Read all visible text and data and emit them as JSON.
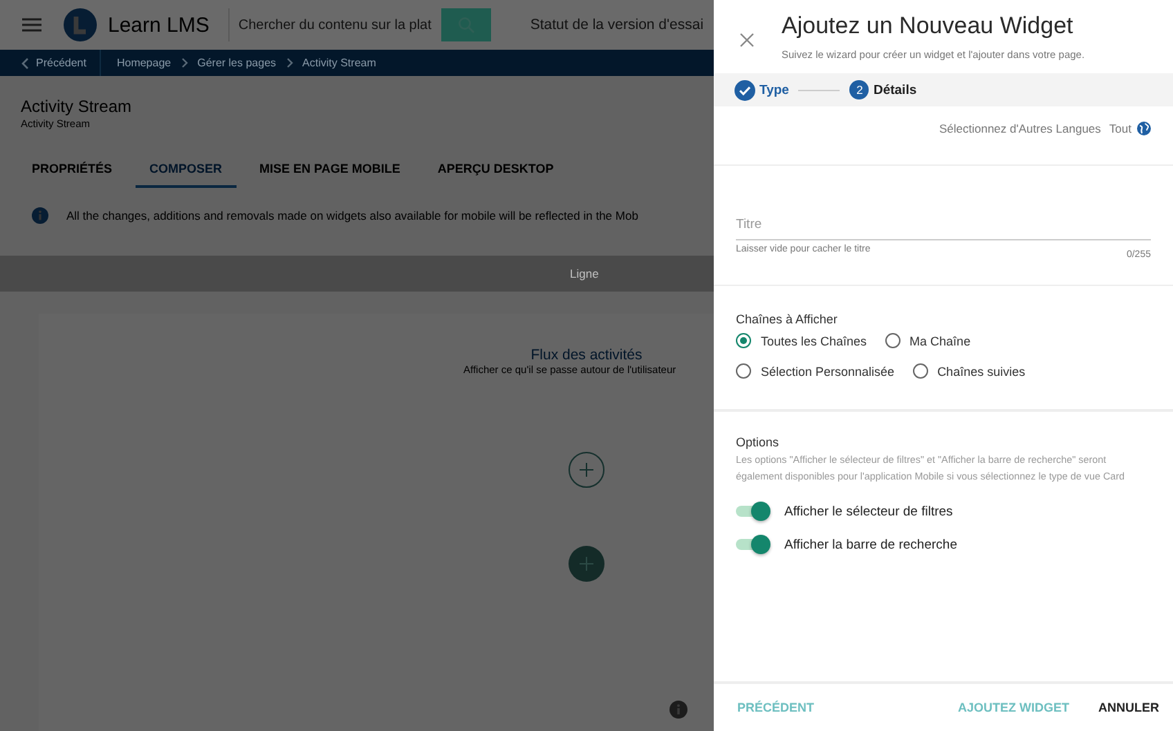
{
  "header": {
    "app_name": "Learn LMS",
    "search": {
      "placeholder": "Chercher du contenu sur la plat"
    },
    "trial_status": "Statut de la version d'essai"
  },
  "breadcrumb": {
    "back": "Précédent",
    "items": [
      "Homepage",
      "Gérer les pages",
      "Activity Stream"
    ]
  },
  "page": {
    "title": "Activity Stream",
    "subtitle": "Activity Stream",
    "tabs": [
      {
        "label": "PROPRIÉTÉS",
        "selected": false
      },
      {
        "label": "COMPOSER",
        "selected": true
      },
      {
        "label": "MISE EN PAGE MOBILE",
        "selected": false
      },
      {
        "label": "APERÇU DESKTOP",
        "selected": false
      }
    ],
    "notice": "All the changes, additions and removals made on widgets also available for mobile will be reflected in the Mob",
    "row_label": "Ligne",
    "widget": {
      "title": "Flux des activités",
      "subtitle": "Afficher ce qu'il se passe autour de l'utilisateur"
    }
  },
  "panel": {
    "title": "Ajoutez un Nouveau Widget",
    "subtitle": "Suivez le wizard pour créer un widget et l'ajouter dans votre page.",
    "steps": [
      {
        "label": "Type",
        "completed": true
      },
      {
        "label": "Détails",
        "number": "2",
        "completed": false
      }
    ],
    "languages": {
      "label": "Sélectionnez d'Autres Langues",
      "value": "Tout"
    },
    "title_field": {
      "placeholder": "Titre",
      "hint": "Laisser vide pour cacher le titre",
      "counter": "0/255"
    },
    "channels": {
      "label": "Chaînes à Afficher",
      "options": [
        {
          "label": "Toutes les Chaînes",
          "selected": true
        },
        {
          "label": "Ma Chaîne",
          "selected": false
        },
        {
          "label": "Sélection Personnalisée",
          "selected": false
        },
        {
          "label": "Chaînes suivies",
          "selected": false
        }
      ]
    },
    "options": {
      "label": "Options",
      "description": "Les options \"Afficher le sélecteur de filtres\" et \"Afficher la barre de recherche\" seront également disponibles pour l'application Mobile si vous sélectionnez le type de vue Card",
      "toggles": [
        {
          "label": "Afficher le sélecteur de filtres",
          "on": true
        },
        {
          "label": "Afficher la barre de recherche",
          "on": true
        }
      ]
    },
    "footer": {
      "previous": "PRÉCÉDENT",
      "add": "AJOUTEZ WIDGET",
      "cancel": "ANNULER"
    }
  }
}
